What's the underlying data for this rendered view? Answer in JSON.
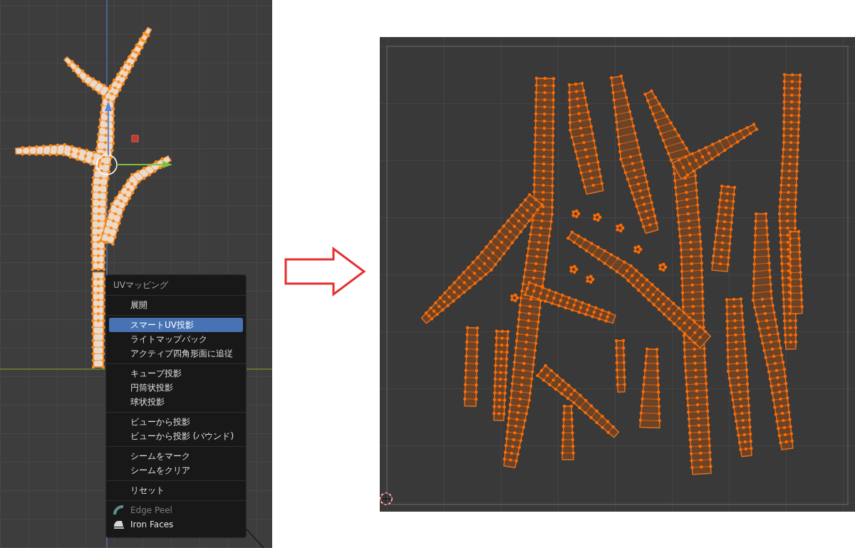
{
  "uv_menu": {
    "title": "UVマッピング",
    "groups": [
      [
        {
          "label": "展開",
          "selected": false,
          "disabled": false,
          "kind": "plain"
        }
      ],
      [
        {
          "label": "スマートUV投影",
          "selected": true,
          "disabled": false,
          "kind": "plain"
        },
        {
          "label": "ライトマップパック",
          "selected": false,
          "disabled": false,
          "kind": "plain"
        },
        {
          "label": "アクティブ四角形面に追従",
          "selected": false,
          "disabled": false,
          "kind": "plain"
        }
      ],
      [
        {
          "label": "キューブ投影",
          "selected": false,
          "disabled": false,
          "kind": "plain"
        },
        {
          "label": "円筒状投影",
          "selected": false,
          "disabled": false,
          "kind": "plain"
        },
        {
          "label": "球状投影",
          "selected": false,
          "disabled": false,
          "kind": "plain"
        }
      ],
      [
        {
          "label": "ビューから投影",
          "selected": false,
          "disabled": false,
          "kind": "plain"
        },
        {
          "label": "ビューから投影 (バウンド)",
          "selected": false,
          "disabled": false,
          "kind": "plain"
        }
      ],
      [
        {
          "label": "シームをマーク",
          "selected": false,
          "disabled": false,
          "kind": "plain"
        },
        {
          "label": "シームをクリア",
          "selected": false,
          "disabled": false,
          "kind": "plain"
        }
      ],
      [
        {
          "label": "リセット",
          "selected": false,
          "disabled": false,
          "kind": "plain"
        }
      ],
      [
        {
          "label": "Edge Peel",
          "selected": false,
          "disabled": true,
          "kind": "arc"
        },
        {
          "label": "Iron Faces",
          "selected": false,
          "disabled": false,
          "kind": "iron"
        }
      ]
    ]
  }
}
